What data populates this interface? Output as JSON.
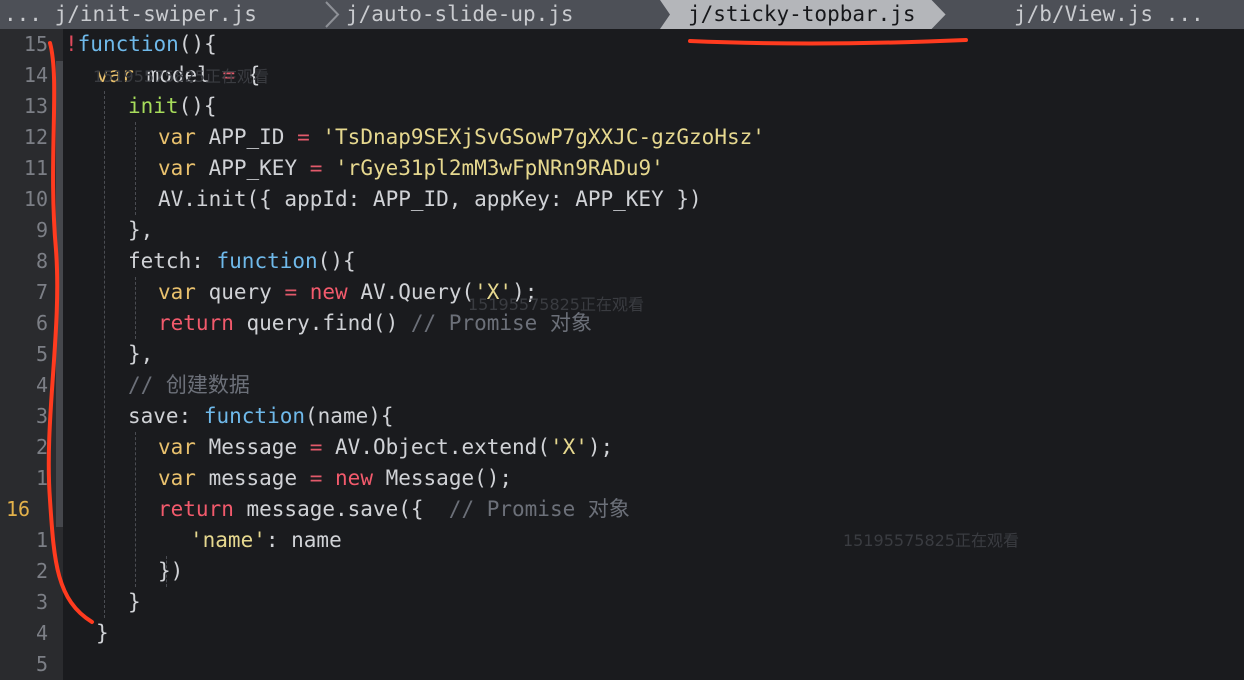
{
  "tabs": [
    {
      "label": "... j/init-swiper.js",
      "active": false
    },
    {
      "label": "j/auto-slide-up.js",
      "active": false
    },
    {
      "label": "j/sticky-topbar.js",
      "active": true
    },
    {
      "label": "j/b/View.js ...",
      "active": false
    }
  ],
  "gutter": [
    "15",
    "14",
    "13",
    "12",
    "11",
    "10",
    "9",
    "8",
    "7",
    "6",
    "5",
    "4",
    "3",
    "2",
    "1",
    "16",
    "1",
    "2",
    "3",
    "4",
    "5"
  ],
  "current_line": "16",
  "watermarks": [
    "15195575825正在观看",
    "15195575825正在观看",
    "15195575825正在观看"
  ],
  "code": {
    "l1": {
      "bang": "!",
      "kw": "function",
      "rest": "(){"
    },
    "l2": {
      "kw": "var",
      "name": " model ",
      "op": "=",
      "rest": " {"
    },
    "l3": {
      "fn": "init",
      "rest": "(){"
    },
    "l4": {
      "kw": "var",
      "name": " APP_ID ",
      "op": "=",
      "str": " 'TsDnap9SEXjSvGSowP7gXXJC-gzGzoHsz'"
    },
    "l5": {
      "kw": "var",
      "name": " APP_KEY ",
      "op": "=",
      "str": " 'rGye31pl2mM3wFpNRn9RADu9'"
    },
    "l6": {
      "rest": "AV.init({ appId: APP_ID, appKey: APP_KEY })"
    },
    "l7": {
      "rest": "},"
    },
    "l8": {
      "name": "fetch: ",
      "fn": "function",
      "rest": "(){"
    },
    "l9": {
      "kw": "var",
      "name": " query ",
      "op": "=",
      "kw2": " new",
      "rest": " AV.Query(",
      "str": "'X'",
      "end": ");"
    },
    "l10": {
      "kw2": "return",
      "rest": " query.find() ",
      "cm": "// Promise 对象"
    },
    "l11": {
      "rest": "},"
    },
    "l12": {
      "cm": "// 创建数据"
    },
    "l13": {
      "name": "save: ",
      "fn": "function",
      "rest": "(name){"
    },
    "l14": {
      "kw": "var",
      "name": " Message ",
      "op": "=",
      "rest": " AV.Object.extend(",
      "str": "'X'",
      "end": ");"
    },
    "l15": {
      "kw": "var",
      "name": " message ",
      "op": "=",
      "kw2": " new",
      "rest": " Message();"
    },
    "l16": {
      "kw2": "return",
      "rest": " message.save({  ",
      "cm": "// Promise 对象"
    },
    "l17": {
      "str": "'name'",
      "rest": ": name"
    },
    "l18": {
      "rest": "})"
    },
    "l19": {
      "rest": "}"
    },
    "l20": {
      "rest": "}"
    }
  },
  "colors": {
    "annotation": "#ff3b1f",
    "tabbar": "#4d5057",
    "active_tab": "#b4b6ba",
    "gutter": "#2a2b2e",
    "editor_bg": "#1a1b1e"
  }
}
